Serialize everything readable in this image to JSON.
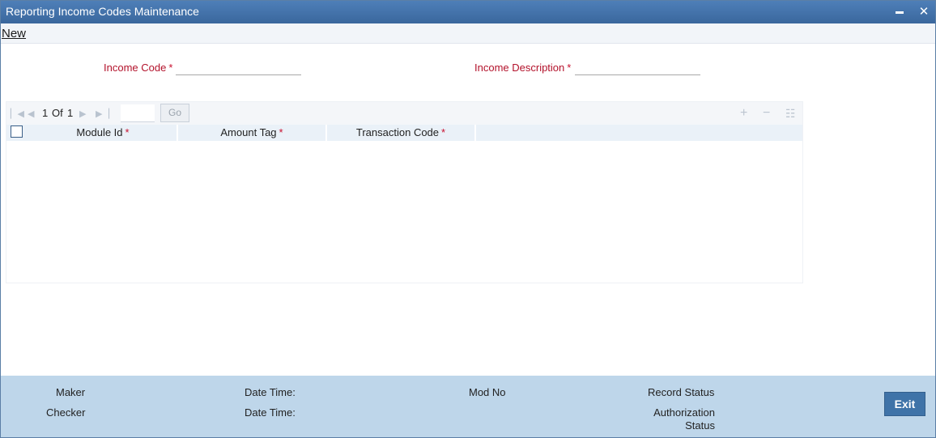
{
  "window": {
    "title": "Reporting Income Codes Maintenance",
    "minimize_glyph": "▬",
    "close_glyph": "✕"
  },
  "menu": {
    "new_label": "New"
  },
  "form": {
    "income_code_label": "Income Code",
    "income_code_value": "",
    "income_description_label": "Income Description",
    "income_description_value": "",
    "required_mark": "*"
  },
  "grid": {
    "pager": {
      "current": "1",
      "of_label": "Of",
      "total": "1",
      "go_label": "Go"
    },
    "icons": [
      "first-page-icon",
      "prev-page-icon",
      "next-page-icon",
      "last-page-icon",
      "add-row-icon",
      "delete-row-icon",
      "list-view-icon"
    ],
    "columns": [
      {
        "label": "Module Id"
      },
      {
        "label": "Amount Tag"
      },
      {
        "label": "Transaction Code"
      }
    ],
    "rows": []
  },
  "footer": {
    "maker_label": "Maker",
    "checker_label": "Checker",
    "datetime_label_1": "Date Time:",
    "datetime_label_2": "Date Time:",
    "modno_label": "Mod No",
    "record_status_label": "Record Status",
    "auth_status_line1": "Authorization",
    "auth_status_line2": "Status",
    "exit_label": "Exit"
  },
  "colors": {
    "titlebar": "#3a679d",
    "required": "#c8102e",
    "footer_bg": "#bed6ea",
    "exit_button": "#3f73a8"
  }
}
